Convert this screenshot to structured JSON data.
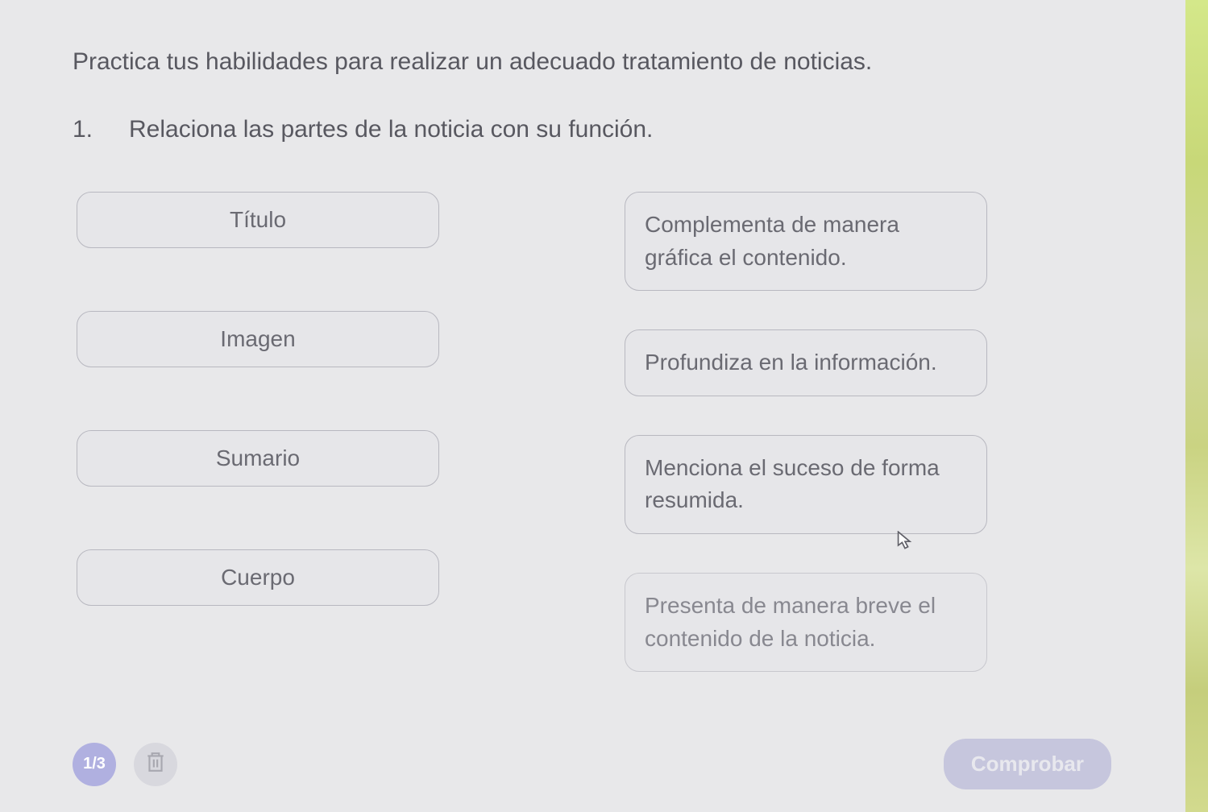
{
  "intro": "Practica tus habilidades para realizar un adecuado tratamiento de noticias.",
  "question": {
    "number": "1.",
    "text": "Relaciona las partes de la noticia con su función."
  },
  "left_items": [
    "Título",
    "Imagen",
    "Sumario",
    "Cuerpo"
  ],
  "right_items": [
    "Complementa de manera gráfica el contenido.",
    "Profundiza en la información.",
    "Menciona el suceso de forma resumida.",
    "Presenta de manera breve el contenido de la noticia."
  ],
  "footer": {
    "page_indicator": "1/3",
    "check_label": "Comprobar"
  }
}
